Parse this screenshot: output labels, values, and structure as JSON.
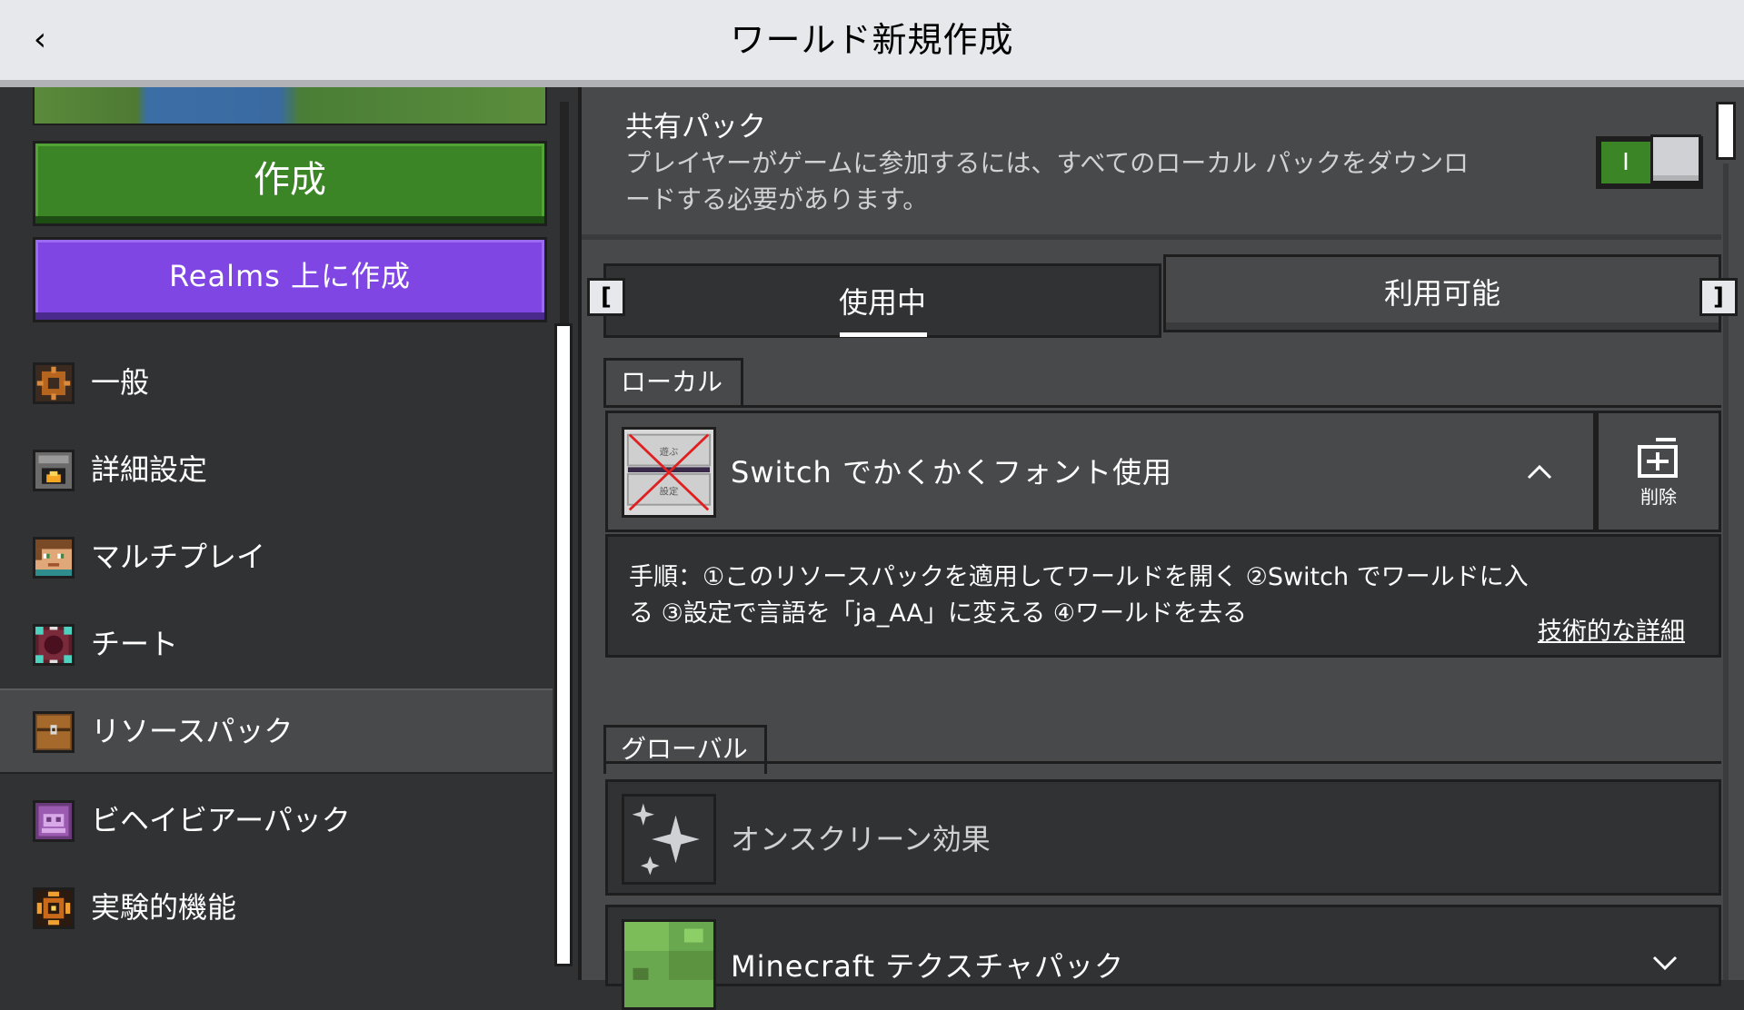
{
  "header": {
    "back_icon": "‹",
    "title": "ワールド新規作成"
  },
  "sidebar": {
    "create_label": "作成",
    "realms_label": "Realms 上に作成",
    "items": [
      {
        "label": "一般",
        "icon": "gear-icon"
      },
      {
        "label": "詳細設定",
        "icon": "furnace-icon"
      },
      {
        "label": "マルチプレイ",
        "icon": "player-head-icon"
      },
      {
        "label": "チート",
        "icon": "command-block-icon"
      },
      {
        "label": "リソースパック",
        "icon": "chest-icon",
        "active": true
      },
      {
        "label": "ビヘイビアーパック",
        "icon": "behavior-pack-icon"
      },
      {
        "label": "実験的機能",
        "icon": "experimental-icon"
      }
    ]
  },
  "shared_pack": {
    "title": "共有パック",
    "description": "プレイヤーがゲームに参加するには、すべてのローカル パックをダウンロードする必要があります。",
    "toggle_on_label": "I",
    "enabled": true
  },
  "tabs": {
    "active": "使用中",
    "inactive": "利用可能",
    "left_bracket": "[",
    "right_bracket": "]"
  },
  "local_section": {
    "title": "ローカル",
    "pack": {
      "name": "Switch でかくかくフォント使用",
      "icon_text_top": "遊ぶ",
      "icon_text_bottom": "設定",
      "remove_label": "削除",
      "description": "手順：①このリソースパックを適用してワールドを開く ②Switch でワールドに入る ③設定で言語を「ja_AA」に変える ④ワールドを去る",
      "details_link": "技術的な詳細"
    }
  },
  "global_section": {
    "title": "グローバル",
    "packs": [
      {
        "name": "オンスクリーン効果",
        "icon": "sparkle-icon"
      },
      {
        "name": "Minecraft テクスチャパック",
        "icon": "grass-block-icon"
      }
    ]
  },
  "colors": {
    "accent_green": "#3c8527",
    "realms_purple": "#7f46e4",
    "panel_dark": "#313233",
    "panel_mid": "#48494a",
    "header_bg": "#e6e8eb"
  }
}
